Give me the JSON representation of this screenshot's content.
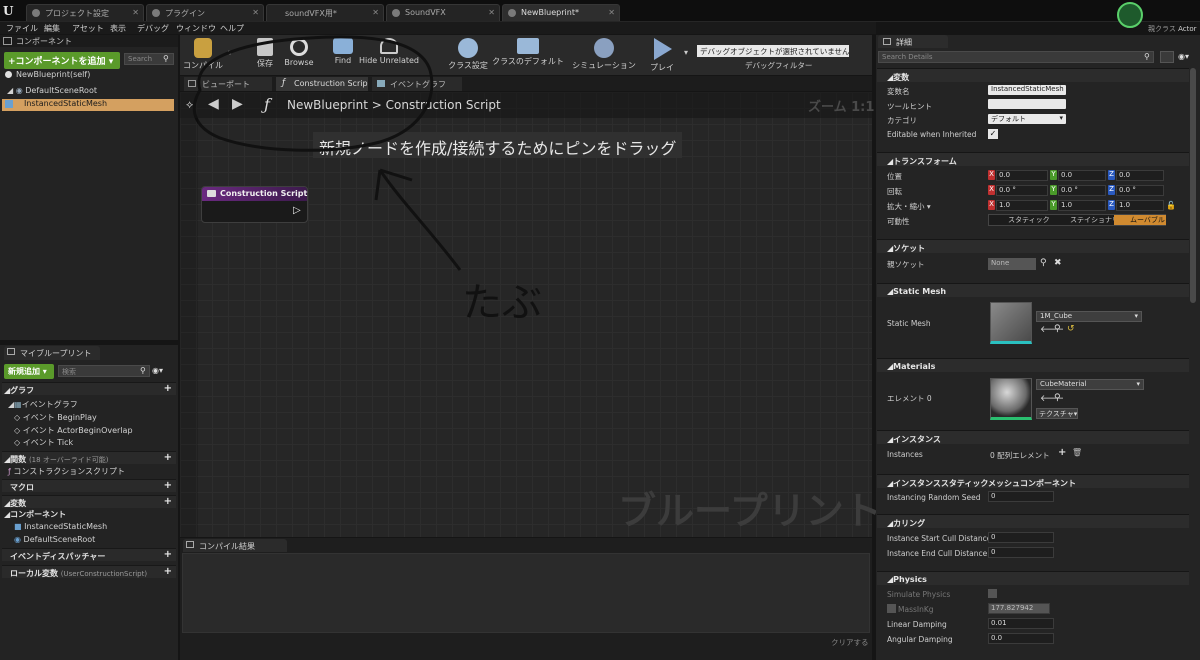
{
  "tabs": [
    {
      "label": "プロジェクト設定"
    },
    {
      "label": "プラグイン"
    },
    {
      "label": "soundVFX用*"
    },
    {
      "label": "SoundVFX"
    },
    {
      "label": "NewBlueprint*"
    }
  ],
  "window": {
    "parent_class_label": "親クラス",
    "parent_class_value": "Actor"
  },
  "menu": [
    "ファイル",
    "編集",
    "アセット",
    "表示",
    "デバッグ",
    "ウィンドウ",
    "ヘルプ"
  ],
  "components": {
    "header": "コンポーネント",
    "add_button": "+コンポーネントを追加",
    "search_placeholder": "Search",
    "self_label": "NewBlueprint(self)",
    "tree": [
      {
        "label": "DefaultSceneRoot"
      },
      {
        "label": "InstancedStaticMesh"
      }
    ]
  },
  "toolbar": {
    "buttons": [
      "コンパイル",
      "保存",
      "Browse",
      "Find",
      "Hide Unrelated",
      "クラス設定",
      "クラスのデフォルト",
      "シミュレーション",
      "プレイ"
    ],
    "debug_select": "デバッグオブジェクトが選択されていません",
    "debug_filter_label": "デバッグフィルター"
  },
  "editor_tabs": [
    "ビューポート",
    "Construction Scrip",
    "イベントグラフ"
  ],
  "graph": {
    "breadcrumb_root": "NewBlueprint",
    "breadcrumb_sep": ">",
    "breadcrumb_leaf": "Construction Script",
    "zoom": "ズーム 1:1",
    "hint": "新規ノードを作成/接続するためにピンをドラッグ",
    "node_title": "Construction Script",
    "watermark": "ブループリント",
    "handwriting": "たぶ"
  },
  "compile": {
    "tab": "コンパイル結果",
    "clear_button": "クリアする"
  },
  "my_blueprint": {
    "header": "マイブループリント",
    "add_button": "新規追加",
    "search_placeholder": "検索",
    "sections": {
      "graphs": "グラフ",
      "event_graph": "イベントグラフ",
      "events": [
        "イベント BeginPlay",
        "イベント ActorBeginOverlap",
        "イベント Tick"
      ],
      "functions": "関数",
      "functions_note": "(18 オーバーライド可能)",
      "construction_script": "コンストラクションスクリプト",
      "macros": "マクロ",
      "variables": "変数",
      "component_group": "コンポーネント",
      "components": [
        "InstancedStaticMesh",
        "DefaultSceneRoot"
      ],
      "dispatchers": "イベントディスパッチャー",
      "local_vars": "ローカル変数",
      "local_vars_note": "(UserConstructionScript)"
    }
  },
  "details": {
    "header": "詳細",
    "search_placeholder": "Search Details",
    "var_section": "変数",
    "var_name_label": "変数名",
    "var_name_value": "InstancedStaticMesh",
    "tooltip_label": "ツールヒント",
    "category_label": "カテゴリ",
    "category_value": "デフォルト",
    "editable_label": "Editable when Inherited",
    "transform_section": "トランスフォーム",
    "location_label": "位置",
    "rotation_label": "回転",
    "scale_label": "拡大・縮小",
    "mobility_label": "可動性",
    "location": [
      "0.0",
      "0.0",
      "0.0"
    ],
    "rotation": [
      "0.0 °",
      "0.0 °",
      "0.0 °"
    ],
    "scale": [
      "1.0",
      "1.0",
      "1.0"
    ],
    "mobility_options": [
      "スタティック",
      "ステイショナリ",
      "ムーバブル"
    ],
    "socket_section": "ソケット",
    "parent_socket_label": "親ソケット",
    "parent_socket_value": "None",
    "static_mesh_section": "Static Mesh",
    "static_mesh_label": "Static Mesh",
    "static_mesh_value": "1M_Cube",
    "materials_section": "Materials",
    "element_label": "エレメント 0",
    "element_value": "CubeMaterial",
    "texture_label": "テクスチャ",
    "instances_section": "インスタンス",
    "instances_label": "Instances",
    "instances_value": "0 配列エレメント",
    "ism_section": "インスタンススタティックメッシュコンポーネント",
    "random_seed_label": "Instancing Random Seed",
    "random_seed_value": "0",
    "culling_section": "カリング",
    "cull_start_label": "Instance Start Cull Distance",
    "cull_start_value": "0",
    "cull_end_label": "Instance End Cull Distance",
    "cull_end_value": "0",
    "physics_section": "Physics",
    "simulate_label": "Simulate Physics",
    "mass_label": "MassInKg",
    "mass_value": "177.827942",
    "linear_damping_label": "Linear Damping",
    "linear_damping_value": "0.01",
    "angular_damping_label": "Angular Damping",
    "angular_damping_value": "0.0"
  },
  "colors": {
    "accent_green": "#5a9a2a",
    "selection": "#d4a060",
    "node_header": "#5a1e6e",
    "axis_x": "#c03030",
    "axis_y": "#4a9a2a",
    "axis_z": "#2a5ac0"
  }
}
